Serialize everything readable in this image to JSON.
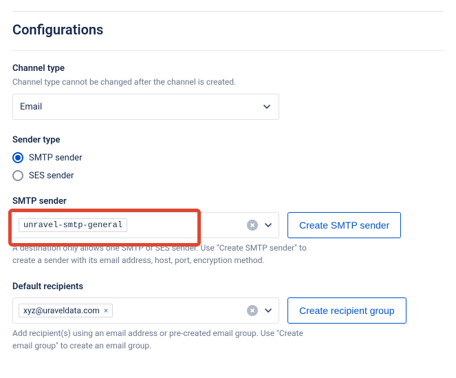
{
  "title": "Configurations",
  "channel_type": {
    "label": "Channel type",
    "help": "Channel type cannot be changed after the channel is created.",
    "value": "Email"
  },
  "sender_type": {
    "label": "Sender type",
    "options": [
      {
        "label": "SMTP sender",
        "checked": true
      },
      {
        "label": "SES sender",
        "checked": false
      }
    ]
  },
  "smtp_sender": {
    "label": "SMTP sender",
    "chip": "unravel-smtp-general",
    "create_btn": "Create SMTP sender",
    "help": "A destination only allows one SMTP or SES sender. Use \"Create SMTP sender\" to create a sender with its email address, host, port, encryption method."
  },
  "default_recipients": {
    "label": "Default recipients",
    "chip": "xyz@uraveldata.com",
    "create_btn": "Create recipient group",
    "help": "Add recipient(s) using an email address or pre-created email group. Use \"Create email group\" to create an email group."
  }
}
